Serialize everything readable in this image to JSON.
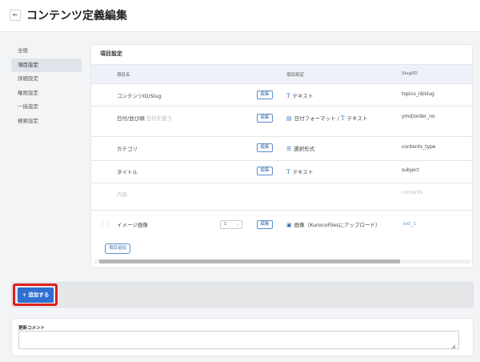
{
  "header": {
    "back_icon": "←",
    "title": "コンテンツ定義編集"
  },
  "sidebar": {
    "items": [
      {
        "label": "全般",
        "active": false
      },
      {
        "label": "項目設定",
        "active": true
      },
      {
        "label": "詳細設定",
        "active": false
      },
      {
        "label": "権限設定",
        "active": false
      },
      {
        "label": "一括設定",
        "active": false
      },
      {
        "label": "検索設定",
        "active": false
      }
    ]
  },
  "card": {
    "title": "項目設定",
    "columns": [
      "項目名",
      "項目設定",
      "Slug/ID"
    ],
    "edit_label": "編集",
    "rows": [
      {
        "name": "コンテンツID/Slug",
        "type": "テキスト",
        "type_icon": "T",
        "slug": "topics_id/slug"
      },
      {
        "name": "日付/並び順",
        "name_hint": "日付を使う",
        "type": "日付フォーマット",
        "type_icon": "calendar-icon",
        "type2": "テキスト",
        "slug": "ymd/order_no"
      },
      {
        "name": "カテゴリ",
        "type": "選択形式",
        "type_icon": "list-icon",
        "slug": "contents_type"
      },
      {
        "name": "タイトル",
        "type": "テキスト",
        "type_icon": "T",
        "slug": "subject"
      },
      {
        "name": "内容",
        "slug": "contents",
        "muted": true
      },
      {
        "name": "イメージ画像",
        "select_value": "1",
        "type": "画像（KurocoFilesにアップロード）",
        "type_icon": "image-icon",
        "slug": "ext_1"
      }
    ],
    "add_item_label": "項目追加"
  },
  "add_button_label": "+ 追加する",
  "comment": {
    "label": "更新コメント",
    "value": ""
  },
  "colors": {
    "accent": "#2f6fd1",
    "highlight": "#e01e1e"
  }
}
